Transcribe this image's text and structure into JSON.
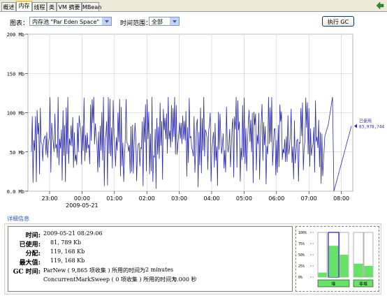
{
  "tabs": [
    {
      "label": "概述",
      "active": false
    },
    {
      "label": "内存",
      "active": true
    },
    {
      "label": "线程",
      "active": false
    },
    {
      "label": "类",
      "active": false
    },
    {
      "label": "VM 摘要",
      "active": false
    },
    {
      "label": "MBean",
      "active": false
    }
  ],
  "toolbar": {
    "chart_label": "图表：",
    "chart_value": "内存池 \"Par Eden Space\"",
    "time_label": "时间范围：",
    "time_value": "全部",
    "gc_button": "执行 GC"
  },
  "chart_data": {
    "type": "line",
    "ylim": [
      0,
      200
    ],
    "y_ticks": [
      "200 Mb",
      "150 Mb",
      "100 Mb",
      "50 Mb",
      "0.0 Mb"
    ],
    "x_ticks": [
      "23:00",
      "00:00",
      "01:00",
      "02:00",
      "03:00",
      "04:00",
      "05:00",
      "06:00",
      "07:00",
      "08:00"
    ],
    "x_date_label": "2009-05-21",
    "series": [
      {
        "name": "已使用",
        "color": "#2B2BA8",
        "last_value_label": "83,978,744"
      }
    ],
    "pattern": {
      "min": 0,
      "max": 120,
      "description_values": [
        30,
        110,
        5,
        95,
        40,
        118,
        12,
        80,
        60,
        115,
        2,
        100
      ]
    }
  },
  "details": {
    "title": "详细信息",
    "time_label": "时间:",
    "time_value": "2009-05-21 08:29:06",
    "used_label": "已使用:",
    "used_value": "81, 789 Kb",
    "committed_label": "分配:",
    "committed_value": "119, 168 Kb",
    "max_label": "最大值:",
    "max_value": "119, 168 Kb",
    "gc_label": "GC 时间:",
    "gc1": "ParNew ( 9,865 项收集 ) 所用的时间为",
    "gc1_time": "2 minutes",
    "gc2": "ConcurrentMarkSweep ( 0 项收集 ) 所用的时间为",
    "gc2_time": "0.000 秒"
  },
  "bars": {
    "pct_labels": [
      "100%",
      "75%",
      "50%",
      "25%",
      "0%"
    ],
    "heap_label": "堆",
    "nonheap_label": "非堆",
    "heap_levels": [
      0.1,
      0.7,
      0.5
    ],
    "nonheap_levels": [
      0.3,
      0.25
    ],
    "bar_color": "#66E266"
  }
}
